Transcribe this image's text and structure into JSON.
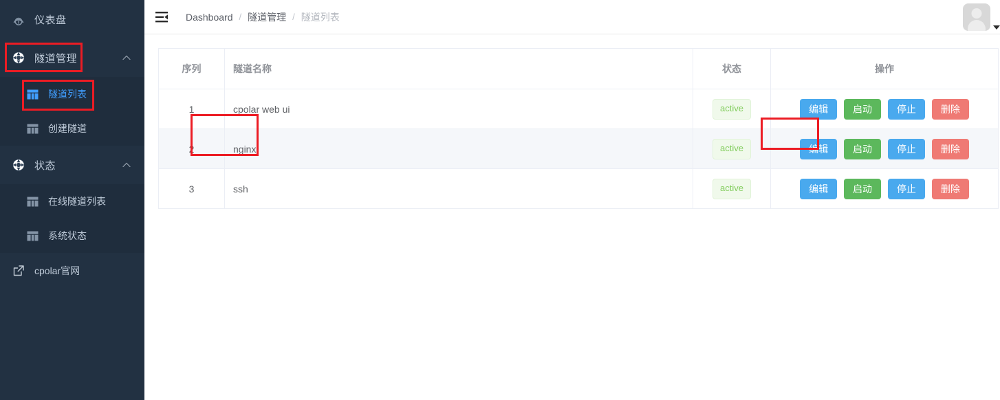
{
  "sidebar": {
    "items": [
      {
        "label": "仪表盘",
        "icon": "dashboard-gauge-icon",
        "type": "menu",
        "expandable": false
      },
      {
        "label": "隧道管理",
        "icon": "tunnel-ring-icon",
        "type": "menu",
        "expandable": true,
        "arrow": "˄"
      },
      {
        "label": "隧道列表",
        "icon": "grid-table-icon",
        "type": "submenu",
        "active": true
      },
      {
        "label": "创建隧道",
        "icon": "grid-table-icon",
        "type": "submenu",
        "active": false
      },
      {
        "label": "状态",
        "icon": "status-ring-icon",
        "type": "menu",
        "expandable": true,
        "arrow": "˄"
      },
      {
        "label": "在线隧道列表",
        "icon": "grid-table-icon",
        "type": "submenu",
        "active": false
      },
      {
        "label": "系统状态",
        "icon": "grid-table-icon",
        "type": "submenu",
        "active": false
      },
      {
        "label": "cpolar官网",
        "icon": "external-link-icon",
        "type": "external"
      }
    ]
  },
  "topbar": {
    "menu_toggle_icon": "fold-menu-icon",
    "breadcrumb": [
      {
        "label": "Dashboard",
        "current": false
      },
      {
        "label": "隧道管理",
        "current": false
      },
      {
        "label": "隧道列表",
        "current": true
      }
    ],
    "breadcrumb_separator": "/",
    "avatar_icon": "user-avatar-icon",
    "avatar_caret_icon": "caret-down-icon"
  },
  "table": {
    "columns": [
      {
        "key": "seq",
        "label": "序列"
      },
      {
        "key": "name",
        "label": "隧道名称"
      },
      {
        "key": "state",
        "label": "状态"
      },
      {
        "key": "ops",
        "label": "操作"
      }
    ],
    "rows": [
      {
        "seq": "1",
        "name": "cpolar web ui",
        "state": "active",
        "hover": false
      },
      {
        "seq": "2",
        "name": "nginx",
        "state": "active",
        "hover": true
      },
      {
        "seq": "3",
        "name": "ssh",
        "state": "active",
        "hover": false
      }
    ],
    "actions": [
      {
        "label": "编辑",
        "style": "primary"
      },
      {
        "label": "启动",
        "style": "success"
      },
      {
        "label": "停止",
        "style": "primary"
      },
      {
        "label": "删除",
        "style": "danger"
      }
    ]
  },
  "annotations": [
    {
      "name": "highlight-tunnel-management",
      "color": "#ec1c24"
    },
    {
      "name": "highlight-tunnel-list",
      "color": "#ec1c24"
    },
    {
      "name": "highlight-nginx-row-name",
      "color": "#ec1c24"
    },
    {
      "name": "highlight-edit-button",
      "color": "#ec1c24"
    }
  ],
  "colors": {
    "sidebar_bg": "#223142",
    "submenu_bg": "#1f2d3d",
    "active_blue": "#409eff",
    "btn_primary": "#49a9ee",
    "btn_success": "#5cb85c",
    "btn_danger": "#ef7a74",
    "badge_text": "#85ce61",
    "badge_bg": "#f0f9eb",
    "annotation_red": "#ec1c24"
  }
}
